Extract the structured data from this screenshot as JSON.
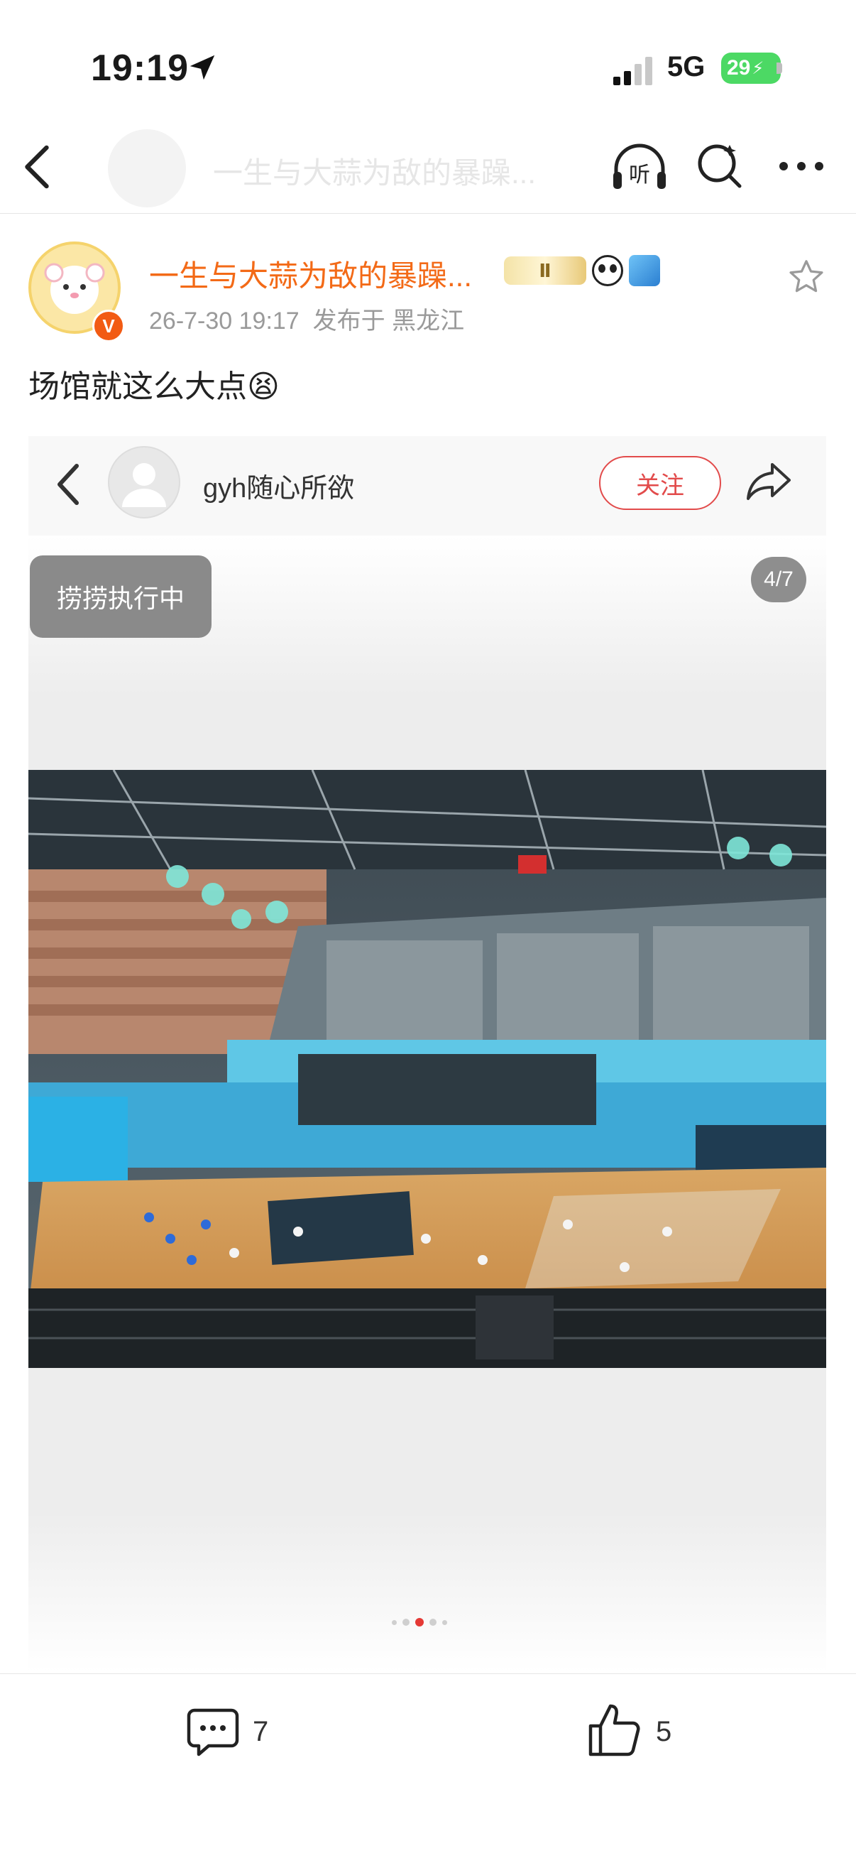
{
  "status_bar": {
    "time": "19:19",
    "network": "5G",
    "battery": "29",
    "icons": [
      "location-arrow-icon",
      "signal-icon",
      "battery-icon"
    ]
  },
  "nav": {
    "title": "一生与大蒜为敌的暴躁...",
    "icons": [
      "back-icon",
      "listen-icon",
      "search-icon",
      "more-icon"
    ],
    "listen_label": "听"
  },
  "post": {
    "author_name": "一生与大蒜为敌的暴躁...",
    "verified_badge": "V",
    "badge_level": "Ⅱ",
    "date": "26-7-30 19:17",
    "location": "发布于 黑龙江",
    "text": "场馆就这么大点",
    "emoji": "😫",
    "brand_color": "#f36a17"
  },
  "embed": {
    "username": "gyh随心所欲",
    "follow_label": "关注",
    "status_chip": "捞捞执行中",
    "counter": "4/7",
    "photo_description_icon": "basketball-arena-photo",
    "dots_total": 5,
    "dots_active": 3
  },
  "footer": {
    "comments": "7",
    "likes": "5"
  }
}
